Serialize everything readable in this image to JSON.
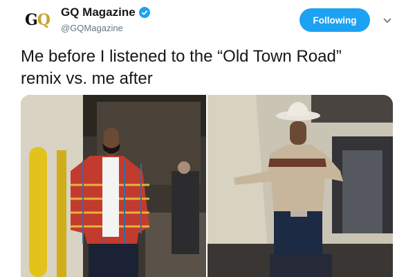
{
  "tweet": {
    "display_name": "GQ Magazine",
    "handle": "@GQMagazine",
    "follow_label": "Following",
    "text_line1": "Me before I listened to the “Old Town Road”",
    "text_line2": "remix vs. me after"
  },
  "avatar": {
    "logo_text_g": "G",
    "logo_text_q": "Q"
  },
  "icons": {
    "verified": "verified-badge-icon",
    "caret": "chevron-down-icon"
  },
  "colors": {
    "accent": "#1da1f2",
    "handle": "#657786",
    "text": "#14171a"
  }
}
